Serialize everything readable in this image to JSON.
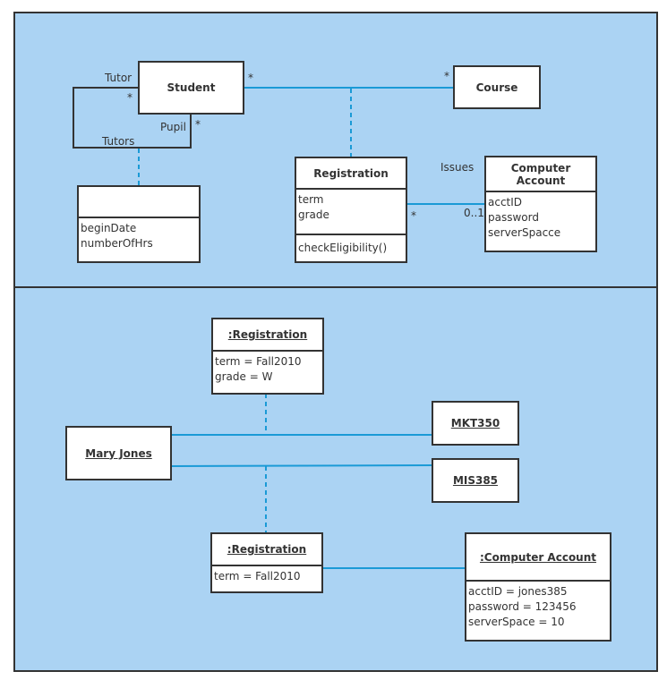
{
  "class_diagram": {
    "student": {
      "name": "Student"
    },
    "course": {
      "name": "Course"
    },
    "registration": {
      "name": "Registration",
      "attributes": [
        "term",
        "grade"
      ],
      "operations": [
        "checkEligibility()"
      ]
    },
    "computer_account": {
      "name": "Computer Account",
      "attributes": [
        "acctID",
        "password",
        "serverSpacce"
      ]
    },
    "tutoring": {
      "name": "",
      "attributes": [
        "beginDate",
        "numberOfHrs"
      ]
    },
    "labels": {
      "tutor": "Tutor",
      "tutor_mult": "*",
      "pupil": "Pupil",
      "pupil_mult": "*",
      "tutors": "Tutors",
      "student_course_mult": "*",
      "course_mult": "*",
      "issues": "Issues",
      "reg_mult": "*",
      "account_mult": "0..1"
    }
  },
  "object_diagram": {
    "registration1": {
      "name": ":Registration",
      "attributes": [
        "term = Fall2010",
        "grade = W"
      ]
    },
    "mary": {
      "name": "Mary Jones"
    },
    "mkt": {
      "name": "MKT350"
    },
    "mis": {
      "name": "MIS385"
    },
    "registration2": {
      "name": ":Registration",
      "attributes": [
        "term = Fall2010"
      ]
    },
    "account": {
      "name": ":Computer Account",
      "attributes": [
        "acctID = jones385",
        "password = 123456",
        "serverSpace = 10"
      ]
    }
  },
  "colors": {
    "background": "#abd3f3",
    "line": "#1a9ad6",
    "border": "#333333"
  }
}
